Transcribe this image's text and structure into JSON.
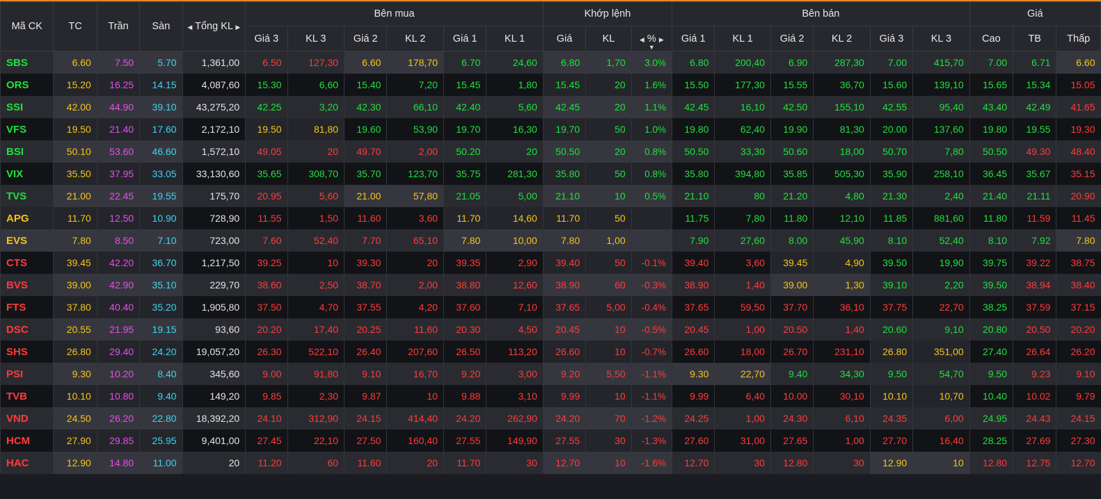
{
  "colors": {
    "up": "#1ee23c",
    "down": "#ff3b3b",
    "ref": "#f5c518",
    "ceiling": "#e44fea",
    "floor": "#3ed5ef",
    "accent": "#e0892a"
  },
  "header": {
    "symbol": "Mã CK",
    "ref": "TC",
    "ceiling": "Trần",
    "floor": "Sàn",
    "total_volume": "Tổng KL",
    "buy_group": "Bên mua",
    "match_group": "Khớp lệnh",
    "sell_group": "Bên bán",
    "price_group": "Giá",
    "price3": "Giá 3",
    "vol3": "KL 3",
    "price2": "Giá 2",
    "vol2": "KL 2",
    "price1": "Giá 1",
    "vol1": "KL 1",
    "match_price": "Giá",
    "match_vol": "KL",
    "match_pct": "%",
    "high": "Cao",
    "avg": "TB",
    "low": "Thấp",
    "left_arrow_icon": "triangle-left-icon",
    "right_arrow_icon": "triangle-right-icon",
    "sort_icon": "triangle-down-icon"
  },
  "rows": [
    {
      "v": [
        "SBS",
        "6.60",
        "7.50",
        "5.70",
        "1,361,00",
        "6.50",
        "127,30",
        "6.60",
        "178,70",
        "6.70",
        "24,60",
        "6.80",
        "1,70",
        "3.0%",
        "6.80",
        "200,40",
        "6.90",
        "287,30",
        "7.00",
        "415,70",
        "7.00",
        "6.71",
        "6.60"
      ],
      "c": [
        "up",
        "ref",
        "ceil",
        "floor",
        "wh",
        "down",
        "down",
        "ref",
        "ref",
        "up",
        "up",
        "up",
        "up",
        "up",
        "up",
        "up",
        "up",
        "up",
        "up",
        "up",
        "up",
        "up",
        "ref"
      ]
    },
    {
      "v": [
        "ORS",
        "15.20",
        "16.25",
        "14.15",
        "4,087,60",
        "15.30",
        "6,60",
        "15.40",
        "7,20",
        "15.45",
        "1,80",
        "15.45",
        "20",
        "1.6%",
        "15.50",
        "177,30",
        "15.55",
        "36,70",
        "15.60",
        "139,10",
        "15.65",
        "15.34",
        "15.05"
      ],
      "c": [
        "up",
        "ref",
        "ceil",
        "floor",
        "wh",
        "up",
        "up",
        "up",
        "up",
        "up",
        "up",
        "up",
        "up",
        "up",
        "up",
        "up",
        "up",
        "up",
        "up",
        "up",
        "up",
        "up",
        "down"
      ]
    },
    {
      "v": [
        "SSI",
        "42.00",
        "44.90",
        "39.10",
        "43,275,20",
        "42.25",
        "3,20",
        "42.30",
        "66,10",
        "42.40",
        "5,60",
        "42.45",
        "20",
        "1.1%",
        "42.45",
        "16,10",
        "42.50",
        "155,10",
        "42.55",
        "95,40",
        "43.40",
        "42.49",
        "41.65"
      ],
      "c": [
        "up",
        "ref",
        "ceil",
        "floor",
        "wh",
        "up",
        "up",
        "up",
        "up",
        "up",
        "up",
        "up",
        "up",
        "up",
        "up",
        "up",
        "up",
        "up",
        "up",
        "up",
        "up",
        "up",
        "down"
      ]
    },
    {
      "v": [
        "VFS",
        "19.50",
        "21.40",
        "17.60",
        "2,172,10",
        "19.50",
        "81,80",
        "19.60",
        "53,90",
        "19.70",
        "16,30",
        "19.70",
        "50",
        "1.0%",
        "19.80",
        "62,40",
        "19.90",
        "81,30",
        "20.00",
        "137,60",
        "19.80",
        "19.55",
        "19.30"
      ],
      "c": [
        "up",
        "ref",
        "ceil",
        "floor",
        "wh",
        "ref",
        "ref",
        "up",
        "up",
        "up",
        "up",
        "up",
        "up",
        "up",
        "up",
        "up",
        "up",
        "up",
        "up",
        "up",
        "up",
        "up",
        "down"
      ]
    },
    {
      "v": [
        "BSI",
        "50.10",
        "53.60",
        "46.60",
        "1,572,10",
        "49.05",
        "20",
        "49.70",
        "2,00",
        "50.20",
        "20",
        "50.50",
        "20",
        "0.8%",
        "50.50",
        "33,30",
        "50.60",
        "18,00",
        "50.70",
        "7,80",
        "50.50",
        "49.30",
        "48.40"
      ],
      "c": [
        "up",
        "ref",
        "ceil",
        "floor",
        "wh",
        "down",
        "down",
        "down",
        "down",
        "up",
        "up",
        "up",
        "up",
        "up",
        "up",
        "up",
        "up",
        "up",
        "up",
        "up",
        "up",
        "down",
        "down"
      ]
    },
    {
      "v": [
        "VIX",
        "35.50",
        "37.95",
        "33.05",
        "33,130,60",
        "35.65",
        "308,70",
        "35.70",
        "123,70",
        "35.75",
        "281,30",
        "35.80",
        "50",
        "0.8%",
        "35.80",
        "394,80",
        "35.85",
        "505,30",
        "35.90",
        "258,10",
        "36.45",
        "35.67",
        "35.15"
      ],
      "c": [
        "up",
        "ref",
        "ceil",
        "floor",
        "wh",
        "up",
        "up",
        "up",
        "up",
        "up",
        "up",
        "up",
        "up",
        "up",
        "up",
        "up",
        "up",
        "up",
        "up",
        "up",
        "up",
        "up",
        "down"
      ]
    },
    {
      "v": [
        "TVS",
        "21.00",
        "22.45",
        "19.55",
        "175,70",
        "20.95",
        "5,60",
        "21.00",
        "57,80",
        "21.05",
        "5,00",
        "21.10",
        "10",
        "0.5%",
        "21.10",
        "80",
        "21.20",
        "4,80",
        "21.30",
        "2,40",
        "21.40",
        "21.11",
        "20.90"
      ],
      "c": [
        "up",
        "ref",
        "ceil",
        "floor",
        "wh",
        "down",
        "down",
        "ref",
        "ref",
        "up",
        "up",
        "up",
        "up",
        "up",
        "up",
        "up",
        "up",
        "up",
        "up",
        "up",
        "up",
        "up",
        "down"
      ]
    },
    {
      "v": [
        "APG",
        "11.70",
        "12.50",
        "10.90",
        "728,90",
        "11.55",
        "1,50",
        "11.60",
        "3,60",
        "11.70",
        "14,60",
        "11.70",
        "50",
        "",
        "11.75",
        "7,80",
        "11.80",
        "12,10",
        "11.85",
        "881,60",
        "11.80",
        "11.59",
        "11.45"
      ],
      "c": [
        "ref",
        "ref",
        "ceil",
        "floor",
        "wh",
        "down",
        "down",
        "down",
        "down",
        "ref",
        "ref",
        "ref",
        "ref",
        "ref",
        "up",
        "up",
        "up",
        "up",
        "up",
        "up",
        "up",
        "down",
        "down"
      ]
    },
    {
      "v": [
        "EVS",
        "7.80",
        "8.50",
        "7.10",
        "723,00",
        "7.60",
        "52,40",
        "7.70",
        "65,10",
        "7.80",
        "10,00",
        "7.80",
        "1,00",
        "",
        "7.90",
        "27,60",
        "8.00",
        "45,90",
        "8.10",
        "52,40",
        "8.10",
        "7.92",
        "7.80"
      ],
      "c": [
        "ref",
        "ref",
        "ceil",
        "floor",
        "wh",
        "down",
        "down",
        "down",
        "down",
        "ref",
        "ref",
        "ref",
        "ref",
        "ref",
        "up",
        "up",
        "up",
        "up",
        "up",
        "up",
        "up",
        "up",
        "ref"
      ]
    },
    {
      "v": [
        "CTS",
        "39.45",
        "42.20",
        "36.70",
        "1,217,50",
        "39.25",
        "10",
        "39.30",
        "20",
        "39.35",
        "2,90",
        "39.40",
        "50",
        "-0.1%",
        "39.40",
        "3,60",
        "39.45",
        "4,90",
        "39.50",
        "19,90",
        "39.75",
        "39.22",
        "38.75"
      ],
      "c": [
        "down",
        "ref",
        "ceil",
        "floor",
        "wh",
        "down",
        "down",
        "down",
        "down",
        "down",
        "down",
        "down",
        "down",
        "down",
        "down",
        "down",
        "ref",
        "ref",
        "up",
        "up",
        "up",
        "down",
        "down"
      ]
    },
    {
      "v": [
        "BVS",
        "39.00",
        "42.90",
        "35.10",
        "229,70",
        "38.60",
        "2,50",
        "38.70",
        "2,00",
        "38.80",
        "12,60",
        "38.90",
        "60",
        "-0.3%",
        "38.90",
        "1,40",
        "39.00",
        "1,30",
        "39.10",
        "2,20",
        "39.50",
        "38.94",
        "38.40"
      ],
      "c": [
        "down",
        "ref",
        "ceil",
        "floor",
        "wh",
        "down",
        "down",
        "down",
        "down",
        "down",
        "down",
        "down",
        "down",
        "down",
        "down",
        "down",
        "ref",
        "ref",
        "up",
        "up",
        "up",
        "down",
        "down"
      ]
    },
    {
      "v": [
        "FTS",
        "37.80",
        "40.40",
        "35.20",
        "1,905,80",
        "37.50",
        "4,70",
        "37.55",
        "4,20",
        "37.60",
        "7,10",
        "37.65",
        "5,00",
        "-0.4%",
        "37.65",
        "59,50",
        "37.70",
        "36,10",
        "37.75",
        "22,70",
        "38.25",
        "37.59",
        "37.15"
      ],
      "c": [
        "down",
        "ref",
        "ceil",
        "floor",
        "wh",
        "down",
        "down",
        "down",
        "down",
        "down",
        "down",
        "down",
        "down",
        "down",
        "down",
        "down",
        "down",
        "down",
        "down",
        "down",
        "up",
        "down",
        "down"
      ]
    },
    {
      "v": [
        "DSC",
        "20.55",
        "21.95",
        "19.15",
        "93,60",
        "20.20",
        "17,40",
        "20.25",
        "11,60",
        "20.30",
        "4,50",
        "20.45",
        "10",
        "-0.5%",
        "20.45",
        "1,00",
        "20.50",
        "1,40",
        "20.60",
        "9,10",
        "20.80",
        "20.50",
        "20.20"
      ],
      "c": [
        "down",
        "ref",
        "ceil",
        "floor",
        "wh",
        "down",
        "down",
        "down",
        "down",
        "down",
        "down",
        "down",
        "down",
        "down",
        "down",
        "down",
        "down",
        "down",
        "up",
        "up",
        "up",
        "down",
        "down"
      ]
    },
    {
      "v": [
        "SHS",
        "26.80",
        "29.40",
        "24.20",
        "19,057,20",
        "26.30",
        "522,10",
        "26.40",
        "207,60",
        "26.50",
        "113,20",
        "26.60",
        "10",
        "-0.7%",
        "26.60",
        "18,00",
        "26.70",
        "231,10",
        "26.80",
        "351,00",
        "27.40",
        "26.64",
        "26.20"
      ],
      "c": [
        "down",
        "ref",
        "ceil",
        "floor",
        "wh",
        "down",
        "down",
        "down",
        "down",
        "down",
        "down",
        "down",
        "down",
        "down",
        "down",
        "down",
        "down",
        "down",
        "ref",
        "ref",
        "up",
        "down",
        "down"
      ]
    },
    {
      "v": [
        "PSI",
        "9.30",
        "10.20",
        "8.40",
        "345,60",
        "9.00",
        "91,80",
        "9.10",
        "16,70",
        "9.20",
        "3,00",
        "9.20",
        "5,50",
        "-1.1%",
        "9.30",
        "22,70",
        "9.40",
        "34,30",
        "9.50",
        "54,70",
        "9.50",
        "9.23",
        "9.10"
      ],
      "c": [
        "down",
        "ref",
        "ceil",
        "floor",
        "wh",
        "down",
        "down",
        "down",
        "down",
        "down",
        "down",
        "down",
        "down",
        "down",
        "ref",
        "ref",
        "up",
        "up",
        "up",
        "up",
        "up",
        "down",
        "down"
      ]
    },
    {
      "v": [
        "TVB",
        "10.10",
        "10.80",
        "9.40",
        "149,20",
        "9.85",
        "2,30",
        "9.87",
        "10",
        "9.88",
        "3,10",
        "9.99",
        "10",
        "-1.1%",
        "9.99",
        "6,40",
        "10.00",
        "30,10",
        "10.10",
        "10,70",
        "10.40",
        "10.02",
        "9.79"
      ],
      "c": [
        "down",
        "ref",
        "ceil",
        "floor",
        "wh",
        "down",
        "down",
        "down",
        "down",
        "down",
        "down",
        "down",
        "down",
        "down",
        "down",
        "down",
        "down",
        "down",
        "ref",
        "ref",
        "up",
        "down",
        "down"
      ]
    },
    {
      "v": [
        "VND",
        "24.50",
        "26.20",
        "22.80",
        "18,392,20",
        "24.10",
        "312,90",
        "24.15",
        "414,40",
        "24.20",
        "262,90",
        "24.20",
        "70",
        "-1.2%",
        "24.25",
        "1,00",
        "24.30",
        "6,10",
        "24.35",
        "6,00",
        "24.95",
        "24.43",
        "24.15"
      ],
      "c": [
        "down",
        "ref",
        "ceil",
        "floor",
        "wh",
        "down",
        "down",
        "down",
        "down",
        "down",
        "down",
        "down",
        "down",
        "down",
        "down",
        "down",
        "down",
        "down",
        "down",
        "down",
        "up",
        "down",
        "down"
      ]
    },
    {
      "v": [
        "HCM",
        "27.90",
        "29.85",
        "25.95",
        "9,401,00",
        "27.45",
        "22,10",
        "27.50",
        "160,40",
        "27.55",
        "149,90",
        "27.55",
        "30",
        "-1.3%",
        "27.60",
        "31,00",
        "27.65",
        "1,00",
        "27.70",
        "16,40",
        "28.25",
        "27.69",
        "27.30"
      ],
      "c": [
        "down",
        "ref",
        "ceil",
        "floor",
        "wh",
        "down",
        "down",
        "down",
        "down",
        "down",
        "down",
        "down",
        "down",
        "down",
        "down",
        "down",
        "down",
        "down",
        "down",
        "down",
        "up",
        "down",
        "down"
      ]
    },
    {
      "v": [
        "HAC",
        "12.90",
        "14.80",
        "11.00",
        "20",
        "11.20",
        "60",
        "11.60",
        "20",
        "11.70",
        "30",
        "12.70",
        "10",
        "-1.6%",
        "12.70",
        "30",
        "12.80",
        "30",
        "12.90",
        "10",
        "12.80",
        "12.75",
        "12.70"
      ],
      "c": [
        "down",
        "ref",
        "ceil",
        "floor",
        "wh",
        "down",
        "down",
        "down",
        "down",
        "down",
        "down",
        "down",
        "down",
        "down",
        "down",
        "down",
        "down",
        "down",
        "ref",
        "ref",
        "down",
        "down",
        "down"
      ]
    }
  ]
}
